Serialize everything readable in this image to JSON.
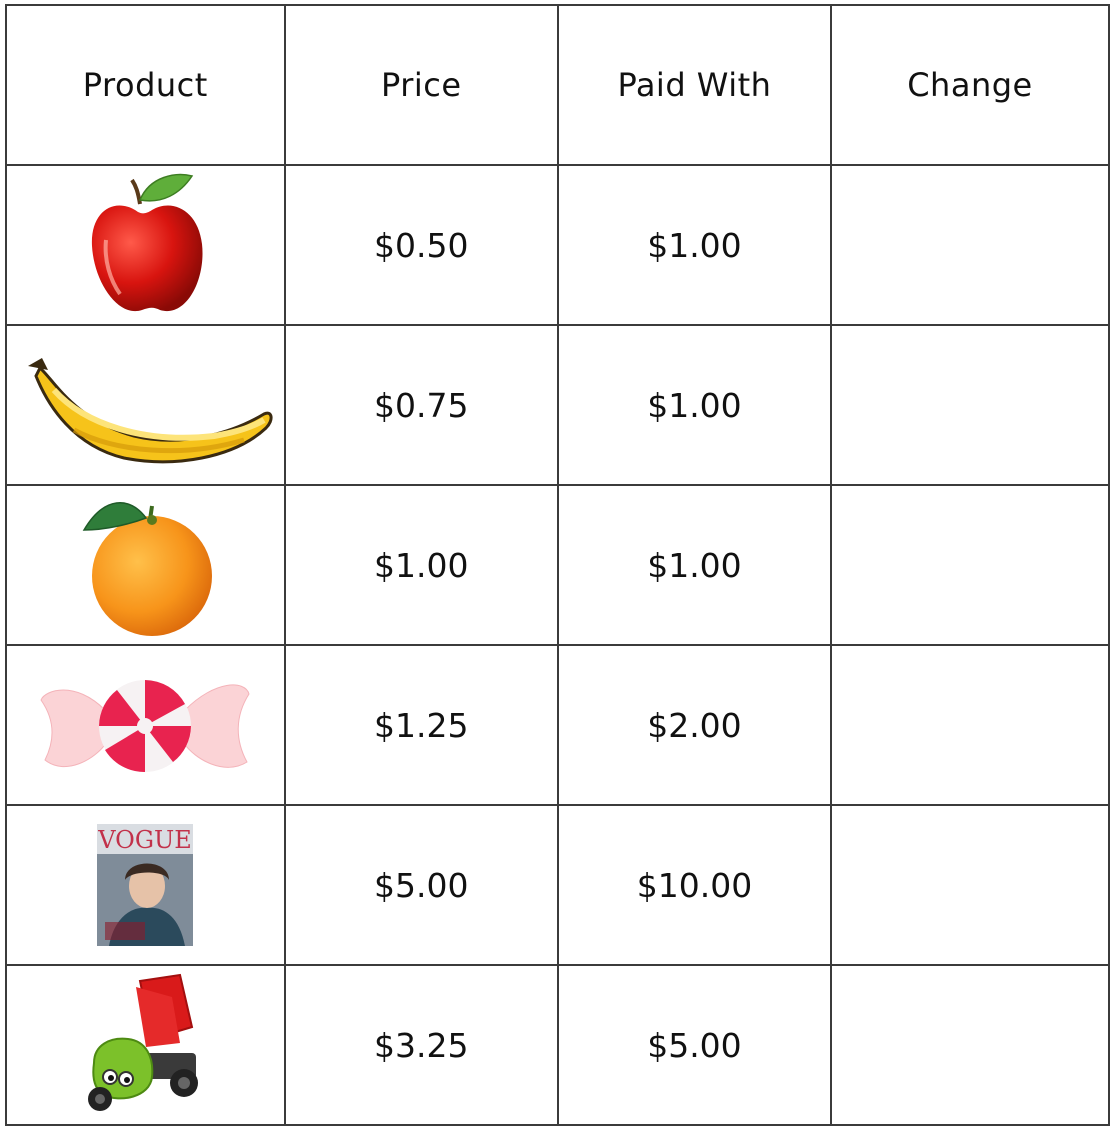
{
  "table": {
    "headers": [
      "Product",
      "Price",
      "Paid With",
      "Change"
    ],
    "rows": [
      {
        "product_icon": "apple-icon",
        "price": "$0.50",
        "paid_with": "$1.00",
        "change": ""
      },
      {
        "product_icon": "banana-icon",
        "price": "$0.75",
        "paid_with": "$1.00",
        "change": ""
      },
      {
        "product_icon": "orange-icon",
        "price": "$1.00",
        "paid_with": "$1.00",
        "change": ""
      },
      {
        "product_icon": "candy-icon",
        "price": "$1.25",
        "paid_with": "$2.00",
        "change": ""
      },
      {
        "product_icon": "magazine-icon",
        "magazine_text": "VOGUE",
        "price": "$5.00",
        "paid_with": "$10.00",
        "change": ""
      },
      {
        "product_icon": "toy-truck-icon",
        "price": "$3.25",
        "paid_with": "$5.00",
        "change": ""
      }
    ]
  }
}
